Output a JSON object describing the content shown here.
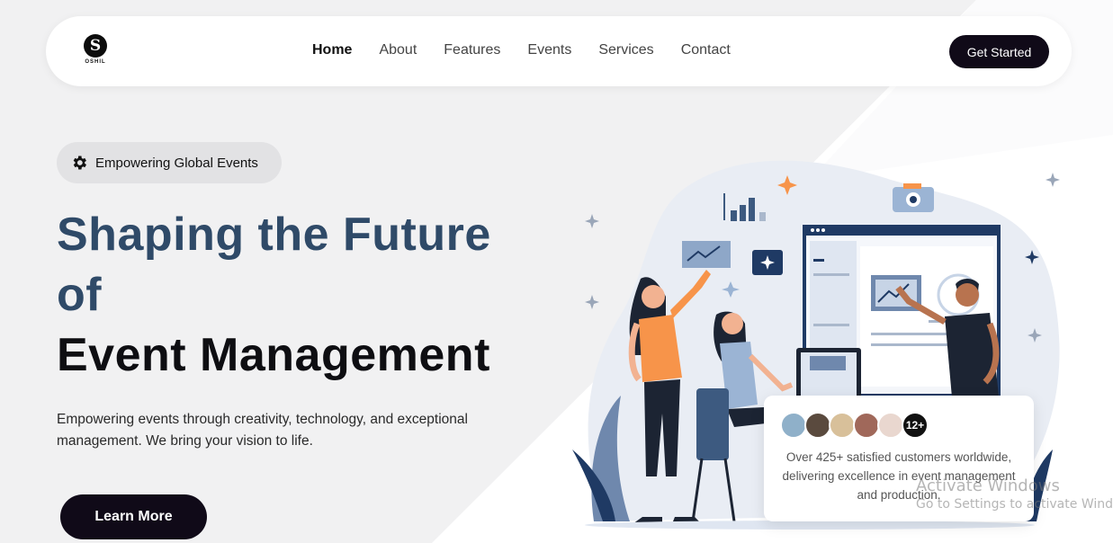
{
  "nav": {
    "logo_letter": "S",
    "logo_text": "OSHIL",
    "links": [
      "Home",
      "About",
      "Features",
      "Events",
      "Services",
      "Contact"
    ],
    "active": "Home",
    "cta": "Get Started"
  },
  "hero": {
    "badge": "Empowering Global Events",
    "title_line1": "Shaping the Future",
    "title_line2": "of",
    "title_line3": "Event Management",
    "lead": "Empowering events through creativity, technology, and exceptional management. We bring your vision to life.",
    "button": "Learn More"
  },
  "testimonial_card": {
    "count_badge": "12+",
    "text": "Over 425+ satisfied customers worldwide, delivering excellence in event management and production."
  },
  "watermark": {
    "line1": "Activate Windows",
    "line2": "Go to Settings to activate Windows."
  },
  "colors": {
    "heading_blue": "#2f4a68",
    "dark": "#100a18",
    "accent_orange": "#f7944a",
    "accent_navy": "#1f3a64"
  },
  "icons": [
    "gear-icon",
    "chart-icon",
    "camera-icon",
    "sparkle-icon"
  ]
}
